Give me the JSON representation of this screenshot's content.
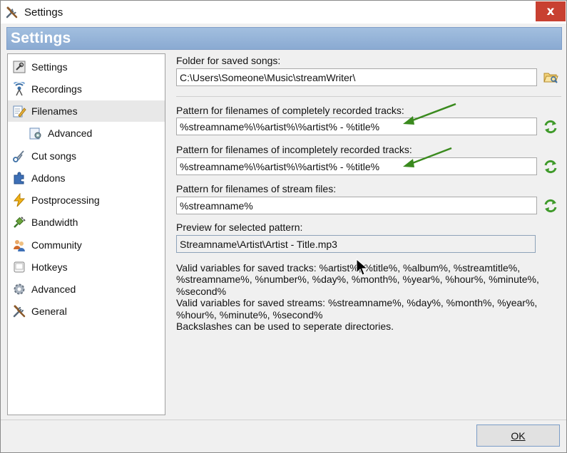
{
  "window": {
    "title": "Settings",
    "close_label": "x",
    "header_title": "Settings"
  },
  "sidebar": {
    "items": [
      {
        "label": "Settings",
        "icon": "settings-icon"
      },
      {
        "label": "Recordings",
        "icon": "recordings-icon"
      },
      {
        "label": "Filenames",
        "icon": "filenames-icon",
        "selected": true
      },
      {
        "label": "Advanced",
        "icon": "advanced-sub-icon",
        "sub": true
      },
      {
        "label": "Cut songs",
        "icon": "cut-songs-icon"
      },
      {
        "label": "Addons",
        "icon": "addons-icon"
      },
      {
        "label": "Postprocessing",
        "icon": "postprocessing-icon"
      },
      {
        "label": "Bandwidth",
        "icon": "bandwidth-icon"
      },
      {
        "label": "Community",
        "icon": "community-icon"
      },
      {
        "label": "Hotkeys",
        "icon": "hotkeys-icon"
      },
      {
        "label": "Advanced",
        "icon": "advanced-icon"
      },
      {
        "label": "General",
        "icon": "general-icon"
      }
    ]
  },
  "content": {
    "folder_label": "Folder for saved songs:",
    "folder_value": "C:\\Users\\Someone\\Music\\streamWriter\\",
    "complete_label": "Pattern for filenames of completely recorded tracks:",
    "complete_value": "%streamname%\\%artist%\\%artist% - %title%",
    "incomplete_label": "Pattern for filenames of incompletely recorded tracks:",
    "incomplete_value": "%streamname%\\%artist%\\%artist% - %title%",
    "stream_label": "Pattern for filenames of stream files:",
    "stream_value": "%streamname%",
    "preview_label": "Preview for selected pattern:",
    "preview_value": "Streamname\\Artist\\Artist - Title.mp3",
    "info_lines": [
      "Valid variables for saved tracks: %artist%, %title%, %album%, %streamtitle%,",
      "%streamname%, %number%, %day%, %month%, %year%, %hour%, %minute%,",
      "%second%",
      "Valid variables for saved streams: %streamname%, %day%, %month%, %year%,",
      "%hour%, %minute%, %second%",
      "Backslashes can be used to seperate directories."
    ]
  },
  "footer": {
    "ok_label": "OK"
  },
  "colors": {
    "banner": "#8aaad2",
    "close": "#c84031",
    "arrow": "#3a8a1e"
  }
}
